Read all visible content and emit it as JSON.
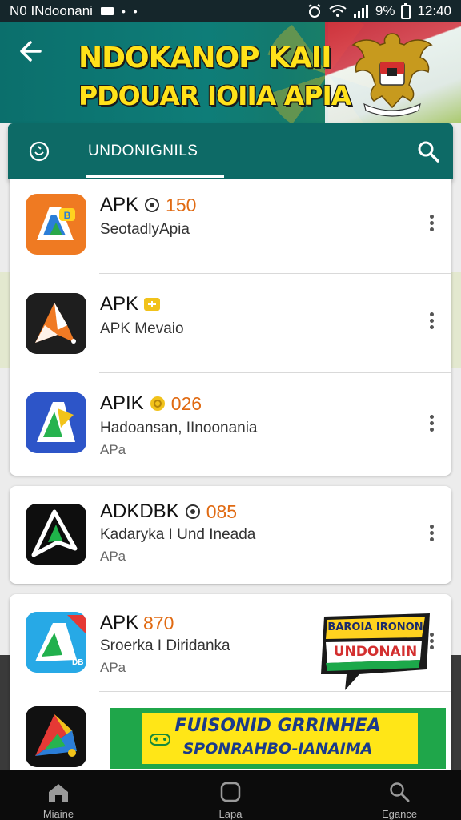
{
  "status_bar": {
    "carrier": "N0 INdoonani",
    "dots": "• •",
    "battery": "9%",
    "time": "12:40"
  },
  "banner": {
    "title_line1": "NDOKANOP KAII",
    "title_line2": "PDOUAR IOIIA APIA"
  },
  "tabs": {
    "active_label": "UNDONIGNILS"
  },
  "apps": [
    {
      "title": "APK",
      "badge": "150",
      "subtitle": "SeotadlyApia",
      "category": ""
    },
    {
      "title": "APK",
      "badge": "",
      "subtitle": "APK Mevaio",
      "category": ""
    },
    {
      "title": "APIK",
      "badge": "026",
      "subtitle": "Hadoansan, IInoonania",
      "category": "APa"
    },
    {
      "title": "ADKDBK",
      "badge": "085",
      "subtitle": "Kadaryka I Und Ineada",
      "category": "APa"
    },
    {
      "title": "APK",
      "badge": "870",
      "subtitle": "Sroerka I Diridanka",
      "category": "APa"
    }
  ],
  "promo_card": {
    "line1": "BAROIA IRONON",
    "line2": "UNDONAIN"
  },
  "bottom_banner": {
    "line1": "FUISONID GRRINHEA",
    "line2": "SPONRAHBO-IANAIMA"
  },
  "bottom_nav": {
    "items": [
      "Miaine",
      "Lapa",
      "Egance"
    ]
  },
  "colors": {
    "teal": "#0d6a66",
    "accent_orange": "#e06a12",
    "banner_yellow": "#ffe21a"
  }
}
